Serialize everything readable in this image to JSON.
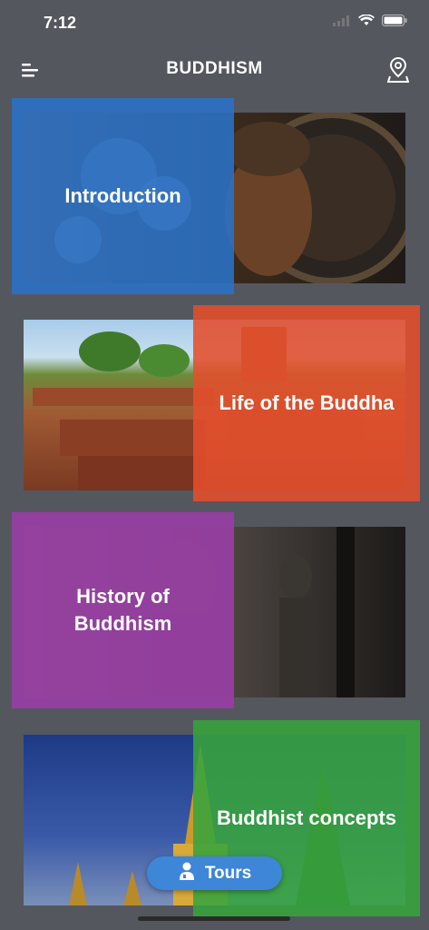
{
  "status_bar": {
    "time": "7:12"
  },
  "navbar": {
    "title": "BUDDHISM"
  },
  "cards": [
    {
      "label": "Introduction",
      "overlay_color": "#2a72c8"
    },
    {
      "label": "Life of the Buddha",
      "overlay_color": "#e44e2c"
    },
    {
      "label": "History of Buddhism",
      "overlay_color": "#9b3da8"
    },
    {
      "label": "Buddhist concepts",
      "overlay_color": "#37a43c"
    }
  ],
  "tours_button": {
    "label": "Tours"
  }
}
